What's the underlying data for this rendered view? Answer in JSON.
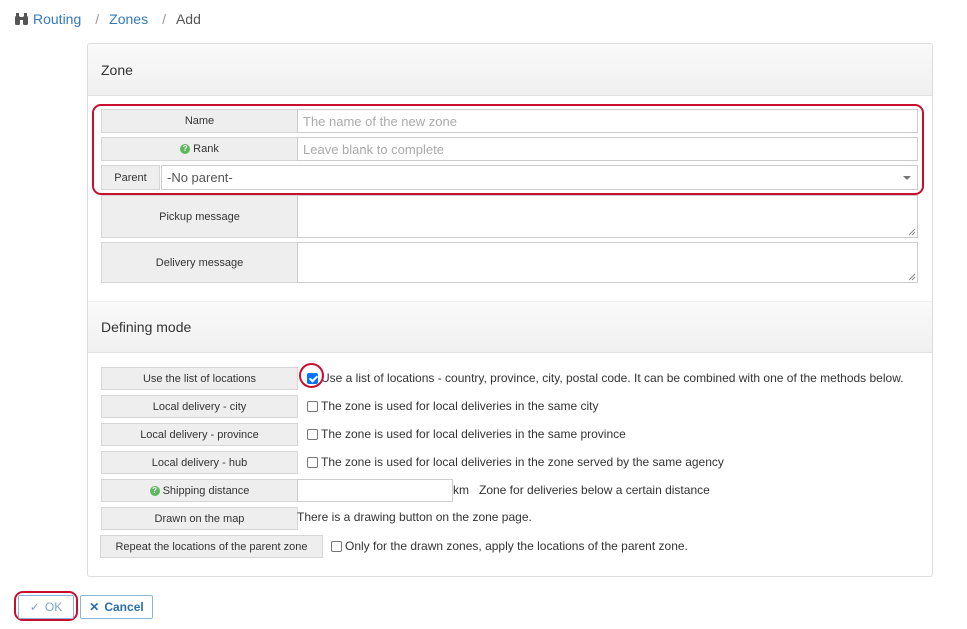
{
  "breadcrumb": {
    "items": [
      {
        "label": "Routing"
      },
      {
        "label": "Zones"
      },
      {
        "label": "Add"
      }
    ],
    "icon": "binoculars-icon"
  },
  "zone_section": {
    "title": "Zone",
    "name": {
      "label": "Name",
      "placeholder": "The name of the new zone",
      "value": ""
    },
    "rank": {
      "label": "Rank",
      "placeholder": "Leave blank to complete",
      "value": "",
      "help_icon": "help-icon"
    },
    "parent": {
      "label": "Parent",
      "selected": "-No parent-"
    },
    "pickup_message": {
      "label": "Pickup message",
      "value": ""
    },
    "delivery_message": {
      "label": "Delivery message",
      "value": ""
    }
  },
  "mode_section": {
    "title": "Defining mode",
    "rows": [
      {
        "label": "Use the list of locations",
        "text": "Use a list of locations - country, province, city, postal code. It can be combined with one of the methods below.",
        "checked": true
      },
      {
        "label": "Local delivery - city",
        "text": "The zone is used for local deliveries in the same city",
        "checked": false
      },
      {
        "label": "Local delivery - province",
        "text": "The zone is used for local deliveries in the same province",
        "checked": false
      },
      {
        "label": "Local delivery - hub",
        "text": "The zone is used for local deliveries in the zone served by the same agency",
        "checked": false
      }
    ],
    "shipping_distance": {
      "label": "Shipping distance",
      "value": "",
      "unit": "km",
      "description": "Zone for deliveries below a certain distance"
    },
    "drawn_on_map": {
      "label": "Drawn on the map",
      "text": "There is a drawing button on the zone page."
    },
    "repeat_parent": {
      "label": "Repeat the locations of the parent zone",
      "text": "Only for the drawn zones, apply the locations of the parent zone.",
      "checked": false
    }
  },
  "actions": {
    "ok_label": "OK",
    "cancel_label": "Cancel"
  },
  "colors": {
    "highlight": "#c8102e",
    "link": "#337ab7",
    "help": "#5cb85c"
  }
}
